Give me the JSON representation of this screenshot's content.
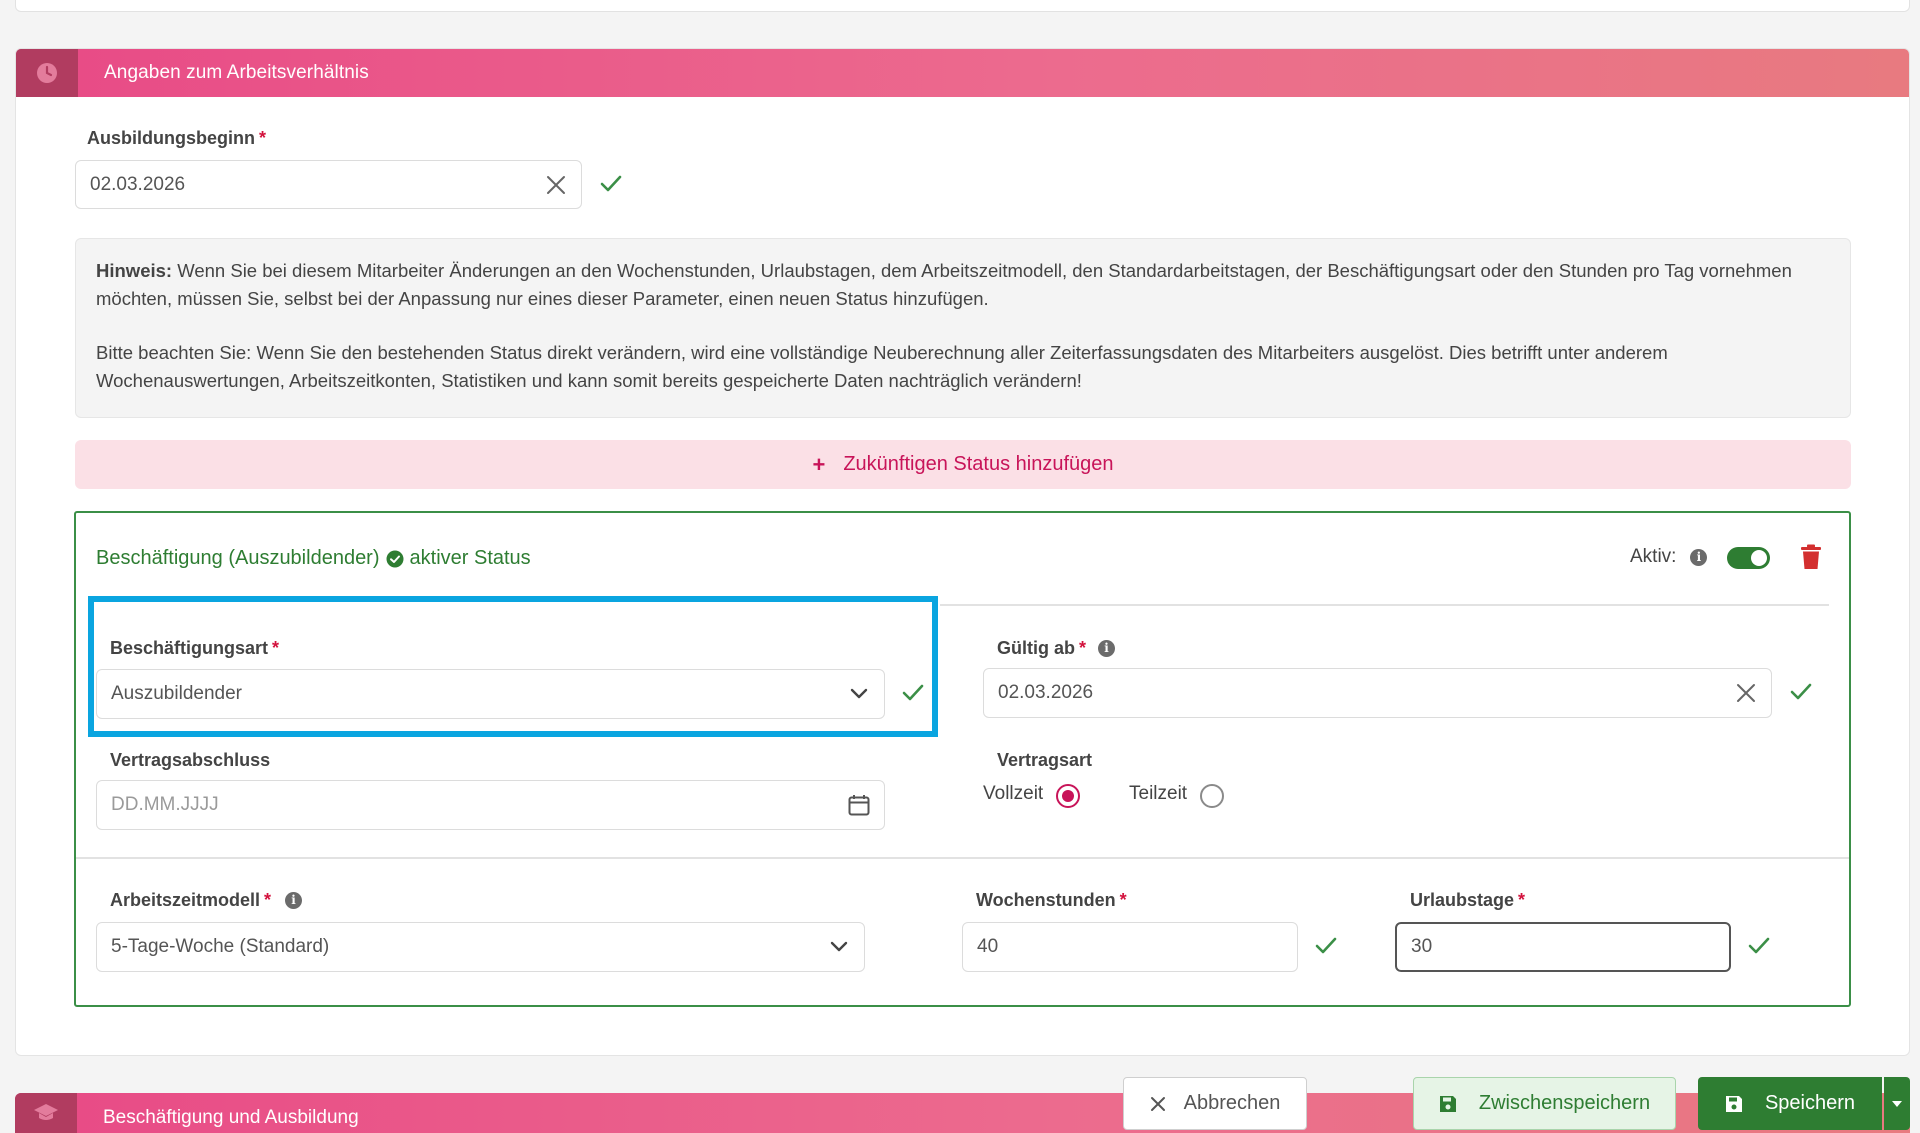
{
  "section1": {
    "title": "Angaben zum Arbeitsverhältnis"
  },
  "ausbildungsbeginn": {
    "label": "Ausbildungsbeginn",
    "required_mark": "*",
    "value": "02.03.2026"
  },
  "hinweis": {
    "bold_prefix": "Hinweis:",
    "line1_rest": " Wenn Sie bei diesem Mitarbeiter Änderungen an den Wochenstunden, Urlaubstagen, dem Arbeitszeitmodell, den Standardarbeitstagen, der Beschäftigungsart oder den Stunden pro Tag vornehmen möchten, müssen Sie, selbst bei der Anpassung nur eines dieser Parameter, einen neuen Status hinzufügen.",
    "paragraph2": "Bitte beachten Sie: Wenn Sie den bestehenden Status direkt verändern, wird eine vollständige Neuberechnung aller Zeiterfassungsdaten des Mitarbeiters ausgelöst. Dies betrifft unter anderem Wochenauswertungen, Arbeitszeitkonten, Statistiken und kann somit bereits gespeicherte Daten nachträglich verändern!"
  },
  "add_status": {
    "plus": "+",
    "label": "Zukünftigen Status hinzufügen"
  },
  "status": {
    "title": "Beschäftigung (Auszubildender)",
    "active_label": "aktiver Status",
    "aktiv_label": "Aktiv:",
    "aktiv_on": true,
    "beschaeftigungsart": {
      "label": "Beschäftigungsart",
      "value": "Auszubildender"
    },
    "gueltig_ab": {
      "label": "Gültig ab",
      "value": "02.03.2026"
    },
    "vertragsabschluss": {
      "label": "Vertragsabschluss",
      "placeholder": "DD.MM.JJJJ"
    },
    "vertragsart": {
      "label": "Vertragsart",
      "option1": "Vollzeit",
      "option2": "Teilzeit",
      "selected": "Vollzeit"
    },
    "arbeitszeitmodell": {
      "label": "Arbeitszeitmodell",
      "value": "5-Tage-Woche (Standard)"
    },
    "wochenstunden": {
      "label": "Wochenstunden",
      "value": "40"
    },
    "urlaubstage": {
      "label": "Urlaubstage",
      "value": "30"
    }
  },
  "section2": {
    "title": "Beschäftigung und Ausbildung"
  },
  "actions": {
    "cancel": "Abbrechen",
    "save_draft": "Zwischenspeichern",
    "save": "Speichern"
  },
  "colors": {
    "accent_pink": "#e84a86",
    "header_icon_bg": "#b13c60",
    "success_green": "#3b8f47",
    "highlight_blue": "#0aa5e0",
    "danger_red": "#d32f2f"
  },
  "icons": {
    "section1": "clock-icon",
    "section2": "graduation-cap-icon",
    "check": "check-icon",
    "clear": "close-icon",
    "calendar": "calendar-icon",
    "delete": "trash-icon"
  }
}
